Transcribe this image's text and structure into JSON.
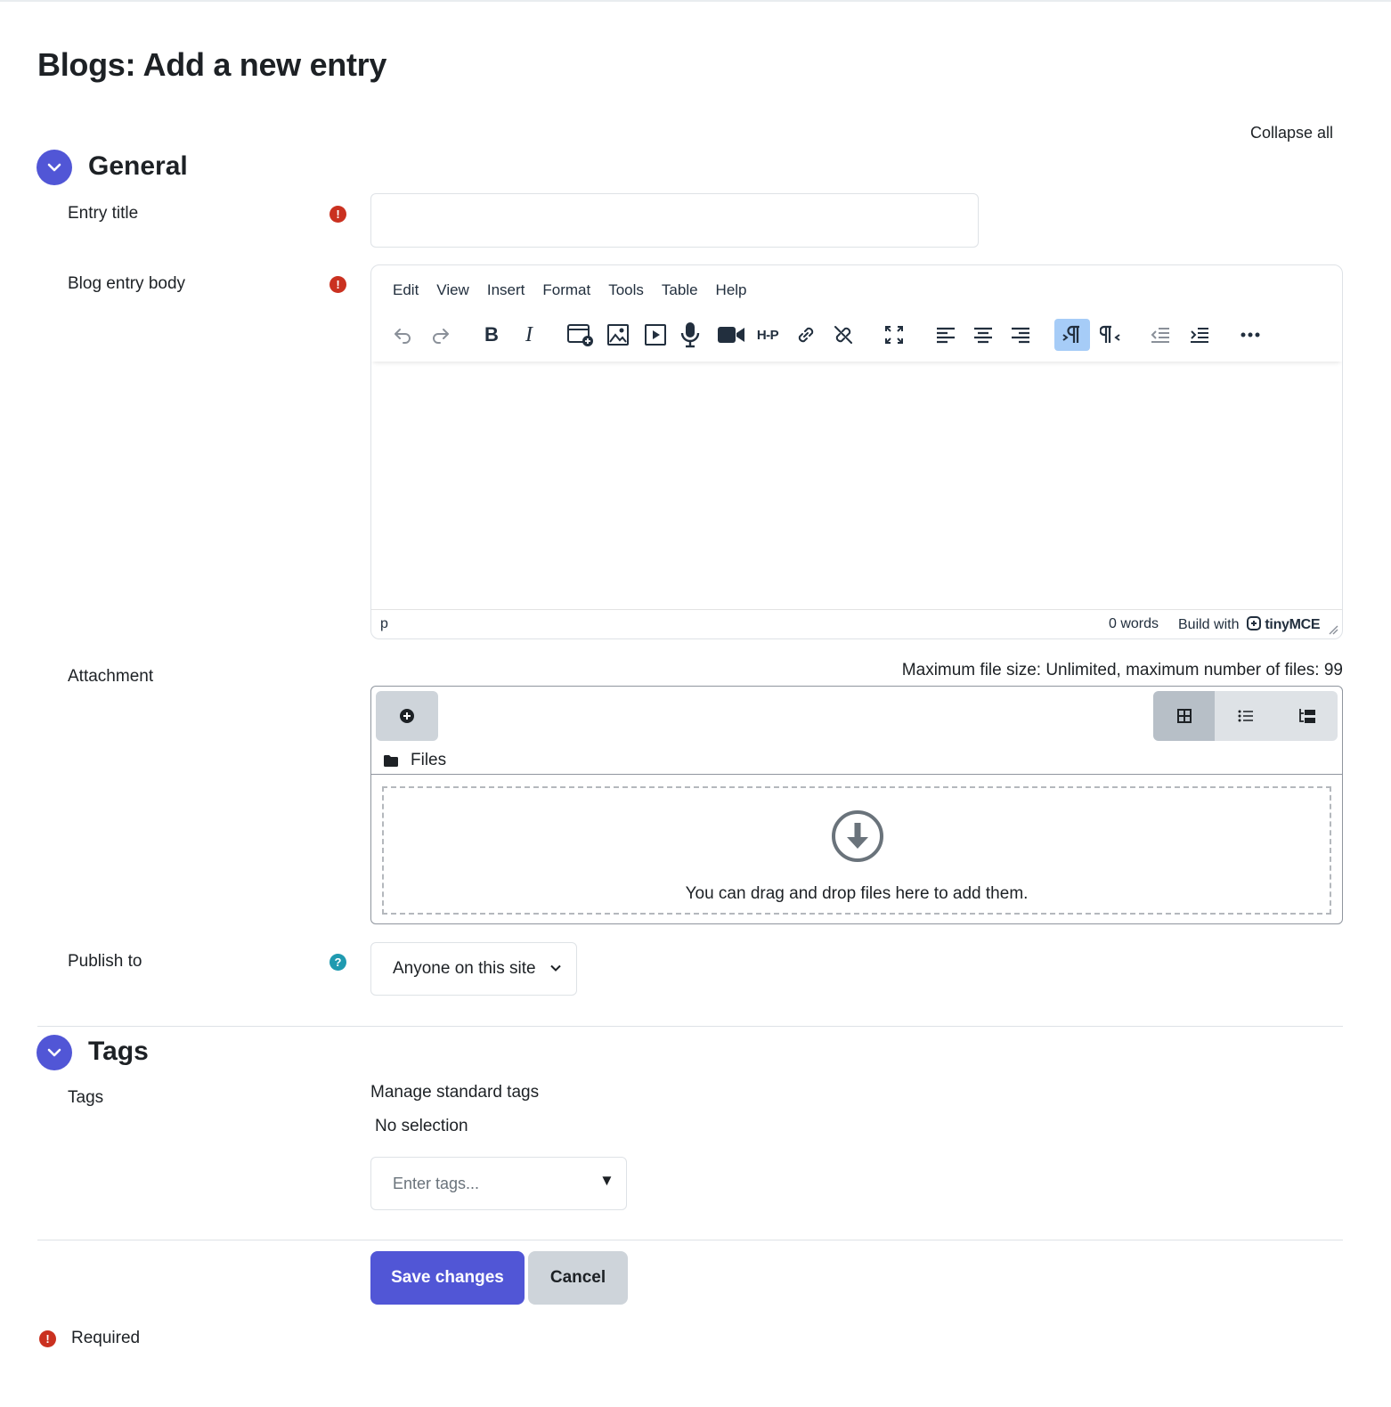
{
  "page": {
    "title": "Blogs: Add a new entry",
    "collapse_all": "Collapse all"
  },
  "colors": {
    "accent": "#5156d6",
    "required": "#ca3120",
    "help": "#1f9ab0",
    "active_toolbar": "#a6ccf7"
  },
  "general": {
    "title": "General",
    "entry_title_label": "Entry title",
    "entry_title_value": "",
    "body_label": "Blog entry body",
    "editor": {
      "menu": [
        "Edit",
        "View",
        "Insert",
        "Format",
        "Tools",
        "Table",
        "Help"
      ],
      "toolbar": [
        "undo-icon",
        "redo-icon",
        "bold-icon",
        "italic-icon",
        "content-bank-icon",
        "image-icon",
        "media-icon",
        "record-audio-icon",
        "record-video-icon",
        "h5p-icon",
        "link-icon",
        "unlink-icon",
        "fullscreen-icon",
        "align-left-icon",
        "align-center-icon",
        "align-right-icon",
        "ltr-icon",
        "rtl-icon",
        "outdent-icon",
        "indent-icon",
        "more-icon"
      ],
      "bold_glyph": "B",
      "italic_glyph": "I",
      "h5p_glyph": "H-P",
      "status_path": "p",
      "word_count": "0 words",
      "brand_prefix": "Build with",
      "brand_name": "tinyMCE"
    },
    "attachment_label": "Attachment",
    "attachment_info": "Maximum file size: Unlimited, maximum number of files: 99",
    "files_label": "Files",
    "drop_text": "You can drag and drop files here to add them.",
    "publish_label": "Publish to",
    "publish_value": "Anyone on this site"
  },
  "tags": {
    "title": "Tags",
    "label": "Tags",
    "manage": "Manage standard tags",
    "no_selection": "No selection",
    "placeholder": "Enter tags...",
    "dropdown_glyph": "▼"
  },
  "buttons": {
    "save": "Save changes",
    "cancel": "Cancel"
  },
  "required_note": "Required",
  "glyphs": {
    "required": "!",
    "help": "?"
  }
}
